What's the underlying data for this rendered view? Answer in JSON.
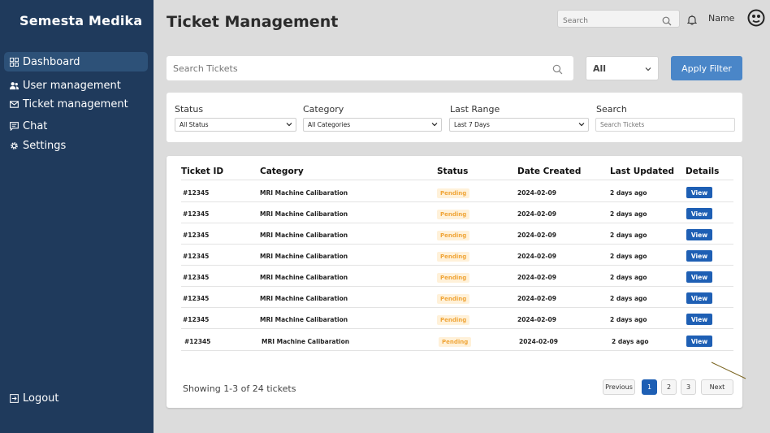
{
  "app": {
    "brand": "Semesta Medika"
  },
  "sidebar": {
    "items": [
      {
        "label": "Dashboard",
        "icon": "dashboard-icon",
        "active": true
      },
      {
        "label": "User management",
        "icon": "users-icon"
      },
      {
        "label": "Ticket management",
        "icon": "mail-icon"
      },
      {
        "label": "Chat",
        "icon": "chat-icon"
      },
      {
        "label": "Settings",
        "icon": "gear-icon"
      }
    ],
    "logout_label": "Logout"
  },
  "header": {
    "title": "Ticket Management",
    "search_placeholder": "Search",
    "user_name": "Name"
  },
  "toolbar": {
    "search_placeholder": "Search Tickets",
    "scope_value": "All",
    "apply_label": "Apply Filter"
  },
  "filters": {
    "status": {
      "label": "Status",
      "value": "All Status"
    },
    "category": {
      "label": "Category",
      "value": "All Categories"
    },
    "range": {
      "label": "Last Range",
      "value": "Last 7 Days"
    },
    "search": {
      "label": "Search",
      "placeholder": "Search Tickets"
    }
  },
  "table": {
    "headers": [
      "Ticket ID",
      "Category",
      "Status",
      "Date Created",
      "Last Updated",
      "Details"
    ],
    "rows": [
      {
        "id": "#12345",
        "category": "MRI Machine Calibaration",
        "status": "Pending",
        "created": "2024-02-09",
        "updated": "2 days ago",
        "action": "View"
      },
      {
        "id": "#12345",
        "category": "MRI Machine Calibaration",
        "status": "Pending",
        "created": "2024-02-09",
        "updated": "2 days ago",
        "action": "View"
      },
      {
        "id": "#12345",
        "category": "MRI Machine Calibaration",
        "status": "Pending",
        "created": "2024-02-09",
        "updated": "2 days ago",
        "action": "View"
      },
      {
        "id": "#12345",
        "category": "MRI Machine Calibaration",
        "status": "Pending",
        "created": "2024-02-09",
        "updated": "2 days ago",
        "action": "View"
      },
      {
        "id": "#12345",
        "category": "MRI Machine Calibaration",
        "status": "Pending",
        "created": "2024-02-09",
        "updated": "2 days ago",
        "action": "View"
      },
      {
        "id": "#12345",
        "category": "MRI Machine Calibaration",
        "status": "Pending",
        "created": "2024-02-09",
        "updated": "2 days ago",
        "action": "View"
      },
      {
        "id": "#12345",
        "category": "MRI Machine Calibaration",
        "status": "Pending",
        "created": "2024-02-09",
        "updated": "2 days ago",
        "action": "View"
      },
      {
        "id": "#12345",
        "category": "MRI Machine Calibaration",
        "status": "Pending",
        "created": "2024-02-09",
        "updated": "2 days ago",
        "action": "View"
      }
    ]
  },
  "pagination": {
    "summary": "Showing 1-3 of 24 tickets",
    "previous_label": "Previous",
    "pages": [
      "1",
      "2",
      "3"
    ],
    "current_page": "1",
    "next_label": "Next"
  },
  "colors": {
    "sidebar_bg": "#1f3a5c",
    "accent": "#1e5fb4",
    "apply_button": "#4a86c8",
    "pending_text": "#f0a63a",
    "pending_bg": "#fff1d9"
  }
}
